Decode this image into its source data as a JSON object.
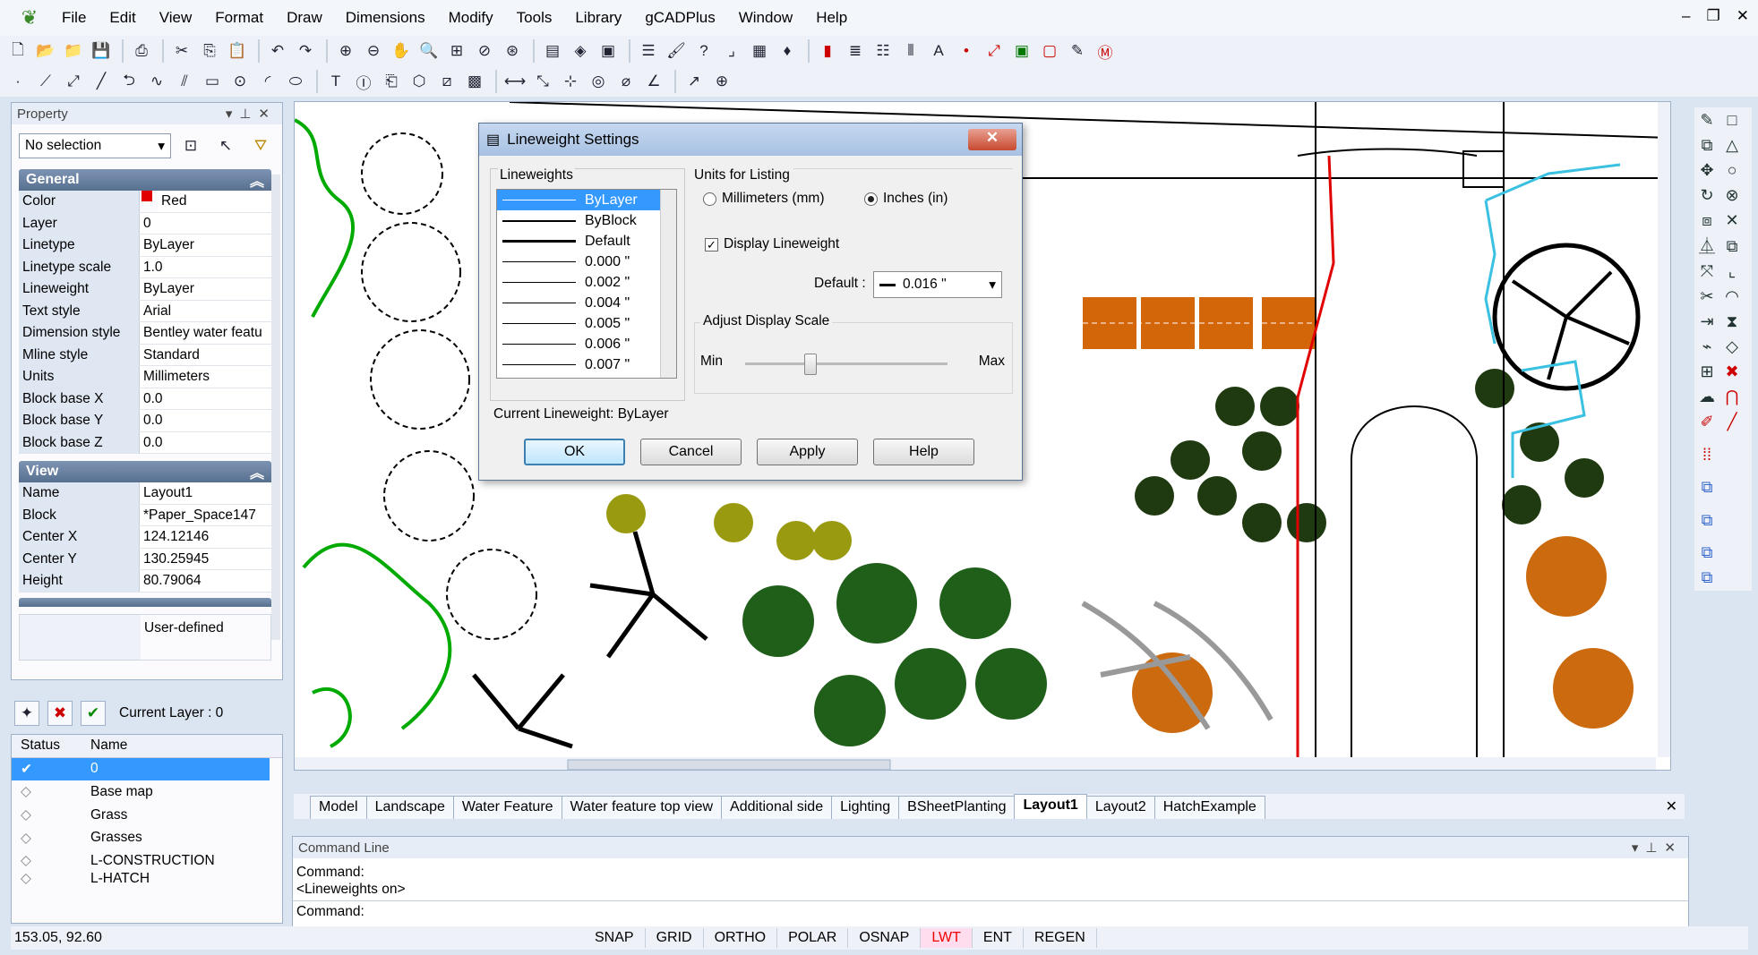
{
  "menubar": {
    "items": [
      "File",
      "Edit",
      "View",
      "Format",
      "Draw",
      "Dimensions",
      "Modify",
      "Tools",
      "Library",
      "gCADPlus",
      "Window",
      "Help"
    ]
  },
  "property_panel": {
    "title": "Property",
    "selection": "No selection",
    "general": {
      "title": "General",
      "rows": [
        [
          "Color",
          "Red"
        ],
        [
          "Layer",
          "0"
        ],
        [
          "Linetype",
          "ByLayer"
        ],
        [
          "Linetype scale",
          "1.0"
        ],
        [
          "Lineweight",
          "ByLayer"
        ],
        [
          "Text style",
          "Arial"
        ],
        [
          "Dimension style",
          "Bentley water featu"
        ],
        [
          "Mline style",
          "Standard"
        ],
        [
          "Units",
          "Millimeters"
        ],
        [
          "Block base X",
          "0.0"
        ],
        [
          "Block base Y",
          "0.0"
        ],
        [
          "Block base Z",
          "0.0"
        ]
      ]
    },
    "view": {
      "title": "View",
      "rows": [
        [
          "Name",
          "Layout1"
        ],
        [
          "Block",
          "*Paper_Space147"
        ],
        [
          "Center X",
          "124.12146"
        ],
        [
          "Center Y",
          "130.25945"
        ],
        [
          "Height",
          "80.79064"
        ]
      ]
    },
    "extra_value": "User-defined"
  },
  "layers": {
    "current": "Current Layer : 0",
    "col_status": "Status",
    "col_name": "Name",
    "items": [
      "0",
      "Base map",
      "Grass",
      "Grasses",
      "L-CONSTRUCTION",
      "L-HATCH"
    ]
  },
  "dialog": {
    "title": "Lineweight Settings",
    "lw_group": "Lineweights",
    "lineweights": [
      "ByLayer",
      "ByBlock",
      "Default",
      "0.000 \"",
      "0.002 \"",
      "0.004 \"",
      "0.005 \"",
      "0.006 \"",
      "0.007 \""
    ],
    "units_group": "Units for Listing",
    "mm": "Millimeters (mm)",
    "inches": "Inches (in)",
    "display_lw": "Display Lineweight",
    "default_label": "Default :",
    "default_value": "0.016 \"",
    "adjust_group": "Adjust Display Scale",
    "min": "Min",
    "max": "Max",
    "current": "Current Lineweight:  ByLayer",
    "ok": "OK",
    "cancel": "Cancel",
    "apply": "Apply",
    "help": "Help"
  },
  "tabs": [
    "Model",
    "Landscape",
    "Water Feature",
    "Water feature top view",
    "Additional side",
    "Lighting",
    "BSheetPlanting",
    "Layout1",
    "Layout2",
    "HatchExample"
  ],
  "command": {
    "title": "Command Line",
    "line1": "Command:",
    "line2": "<Lineweights on>",
    "prompt": "Command:"
  },
  "status": {
    "coords": "153.05, 92.60",
    "buttons": [
      "SNAP",
      "GRID",
      "ORTHO",
      "POLAR",
      "OSNAP",
      "LWT",
      "ENT",
      "REGEN"
    ]
  }
}
